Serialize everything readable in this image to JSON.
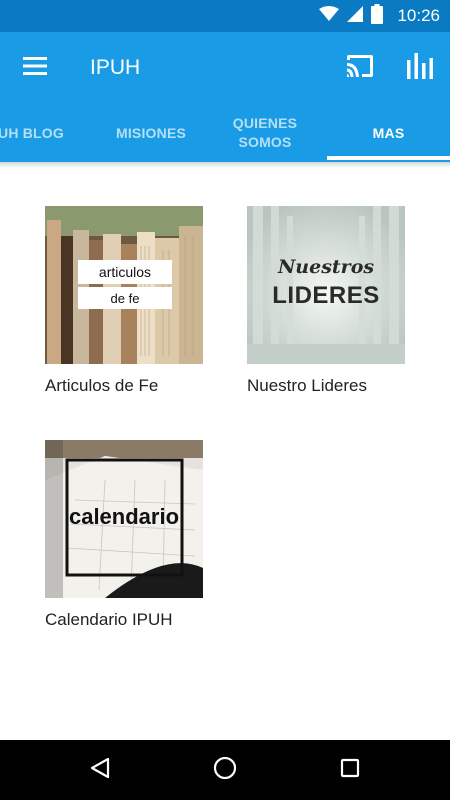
{
  "status_bar": {
    "time": "10:26"
  },
  "app_bar": {
    "title": "IPUH"
  },
  "tabs": [
    {
      "label": "UH BLOG",
      "active": false
    },
    {
      "label": "MISIONES",
      "active": false
    },
    {
      "label": "QUIENES SOMOS",
      "active": false
    },
    {
      "label": "MAS",
      "active": true
    }
  ],
  "items": [
    {
      "label": "Articulos de Fe",
      "thumb_text": [
        "articulos",
        "de fe"
      ]
    },
    {
      "label": "Nuestro Lideres",
      "thumb_text": [
        "Nuestros",
        "LIDERES"
      ]
    },
    {
      "label": "Calendario IPUH",
      "thumb_text": [
        "calendario"
      ]
    }
  ],
  "colors": {
    "status_bar": "#0a7bc2",
    "app_bar": "#1a9be6",
    "nav_bar": "#000000"
  }
}
